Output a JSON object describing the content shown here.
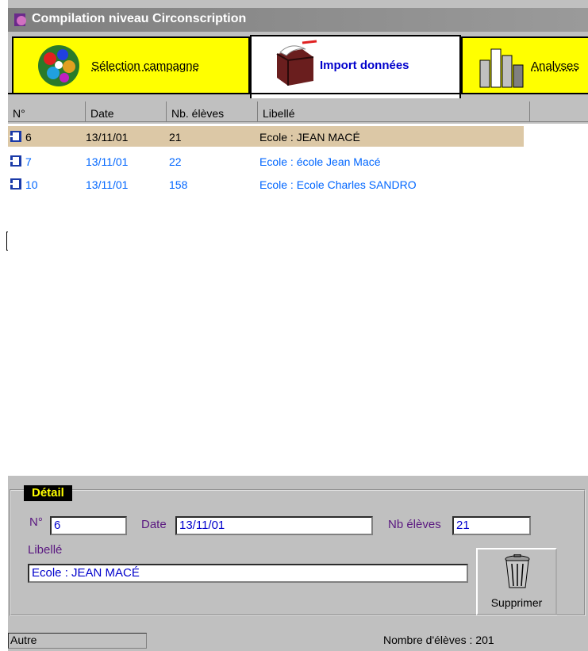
{
  "window": {
    "title": "Compilation niveau Circonscription"
  },
  "tabs": [
    {
      "label": "Sélection campagne",
      "icon": "molecule-icon"
    },
    {
      "label": "Import données",
      "icon": "box-import-icon"
    },
    {
      "label": "Analyses",
      "icon": "bar-chart-icon"
    }
  ],
  "grid": {
    "headers": [
      "N°",
      "Date",
      "Nb. élèves",
      "Libellé"
    ],
    "rows": [
      {
        "num": "6",
        "date": "13/11/01",
        "nb": "21",
        "libelle": "Ecole : JEAN MACÉ"
      },
      {
        "num": "7",
        "date": "13/11/01",
        "nb": "22",
        "libelle": "Ecole : école Jean Macé"
      },
      {
        "num": "10",
        "date": "13/11/01",
        "nb": "158",
        "libelle": "Ecole : Ecole Charles SANDRO"
      }
    ]
  },
  "detail": {
    "title": "Détail",
    "num_label": "N°",
    "num_value": "6",
    "date_label": "Date",
    "date_value": "13/11/01",
    "nb_label": "Nb élèves",
    "nb_value": "21",
    "libelle_label": "Libellé",
    "libelle_value": "Ecole : JEAN MACÉ",
    "delete_label": "Supprimer"
  },
  "status": {
    "left": "Autre",
    "right": "Nombre d'élèves :  201"
  },
  "fragment": "F",
  "colors": {
    "tab_yellow": "#ffff00",
    "title_grey": "#808080",
    "link_blue": "#0066ff",
    "selected_row": "#dcc8a6"
  }
}
